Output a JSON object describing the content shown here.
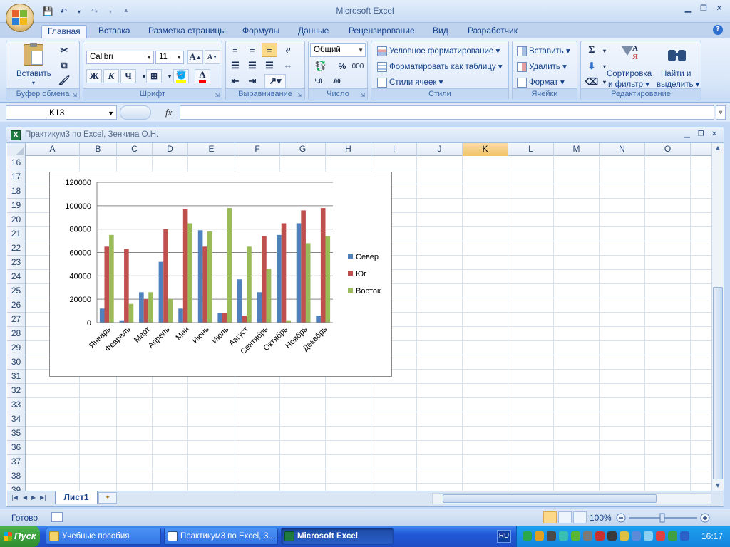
{
  "app": {
    "title": "Microsoft Excel"
  },
  "ribbon": {
    "tabs": [
      "Главная",
      "Вставка",
      "Разметка страницы",
      "Формулы",
      "Данные",
      "Рецензирование",
      "Вид",
      "Разработчик"
    ],
    "active_tab": "Главная",
    "clipboard": {
      "label": "Буфер обмена",
      "paste": "Вставить"
    },
    "font": {
      "label": "Шрифт",
      "name": "Calibri",
      "size": "11",
      "bold": "Ж",
      "italic": "К",
      "underline": "Ч",
      "grow": "A",
      "shrink": "A",
      "color_letter": "A"
    },
    "alignment": {
      "label": "Выравнивание"
    },
    "number": {
      "label": "Число",
      "format": "Общий",
      "percent": "%",
      "thousands": "000"
    },
    "styles": {
      "label": "Стили",
      "conditional": "Условное форматирование",
      "as_table": "Форматировать как таблицу",
      "cell_styles": "Стили ячеек"
    },
    "cells": {
      "label": "Ячейки",
      "insert": "Вставить",
      "delete": "Удалить",
      "format": "Формат"
    },
    "editing": {
      "label": "Редактирование",
      "sort_line1": "Сортировка",
      "sort_line2": "и фильтр",
      "find_line1": "Найти и",
      "find_line2": "выделить"
    }
  },
  "formula_bar": {
    "name_box": "K13",
    "fx": "fx",
    "formula": ""
  },
  "workbook": {
    "title": "Практикум3 по Excel, Зенкина О.Н.",
    "columns": [
      "A",
      "B",
      "C",
      "D",
      "E",
      "F",
      "G",
      "H",
      "I",
      "J",
      "K",
      "L",
      "M",
      "N",
      "O"
    ],
    "selected_column": "K",
    "rows": [
      "16",
      "17",
      "18",
      "19",
      "20",
      "21",
      "22",
      "23",
      "24",
      "25",
      "26",
      "27",
      "28",
      "29",
      "30",
      "31",
      "32",
      "33",
      "34",
      "35",
      "36",
      "37",
      "38",
      "39"
    ],
    "sheet_tab": "Лист1"
  },
  "chart_data": {
    "type": "bar",
    "categories": [
      "Январь",
      "Февраль",
      "Март",
      "Апрель",
      "Май",
      "Июнь",
      "Июль",
      "Август",
      "Сентябрь",
      "Октябрь",
      "Ноябрь",
      "Декабрь"
    ],
    "series": [
      {
        "name": "Север",
        "color": "#4f81bd",
        "values": [
          12000,
          2000,
          26000,
          52000,
          12000,
          79000,
          8000,
          37000,
          26000,
          75000,
          85000,
          6000
        ]
      },
      {
        "name": "Юг",
        "color": "#c0504d",
        "values": [
          65000,
          63000,
          20000,
          80000,
          97000,
          65000,
          8000,
          6000,
          74000,
          85000,
          96000,
          98000
        ]
      },
      {
        "name": "Восток",
        "color": "#9bbb59",
        "values": [
          75000,
          16000,
          26000,
          20000,
          85000,
          78000,
          98000,
          65000,
          46000,
          2000,
          68000,
          74000
        ]
      }
    ],
    "ylim": [
      0,
      120000
    ],
    "yticks": [
      "0",
      "20000",
      "40000",
      "60000",
      "80000",
      "100000",
      "120000"
    ],
    "grid": true,
    "legend": "right"
  },
  "status": {
    "ready": "Готово",
    "zoom": "100%"
  },
  "taskbar": {
    "start": "Пуск",
    "items": [
      "Учебные пособия",
      "Практикум3 по Excel, З...",
      "Microsoft Excel"
    ],
    "active_item": "Microsoft Excel",
    "lang": "RU",
    "clock": "16:17"
  }
}
